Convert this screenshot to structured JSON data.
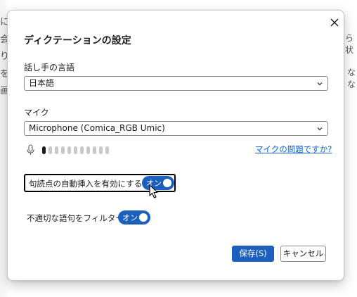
{
  "background": {
    "left_chars": [
      "に",
      "会",
      "り",
      "を",
      "画"
    ],
    "right_chars": [
      "ら 状",
      "なな"
    ]
  },
  "dialog": {
    "title": "ディクテーションの設定",
    "close_icon": "close-icon",
    "language": {
      "label": "話し手の言語",
      "value": "日本語"
    },
    "microphone": {
      "label": "マイク",
      "value": "Microphone (Comica_RGB Umic)",
      "level_icon": "microphone-icon",
      "level_active": 1,
      "level_total": 11,
      "help_link": "マイクの問題ですか?"
    },
    "auto_punctuation": {
      "label": "句読点の自動挿入を有効にする",
      "state": "オン"
    },
    "profanity_filter": {
      "label": "不適切な語句をフィルター",
      "state": "オン"
    },
    "save_button": "保存(S)",
    "cancel_button": "キャンセル"
  },
  "colors": {
    "accent": "#1c5fbd",
    "link": "#0f62c4"
  }
}
